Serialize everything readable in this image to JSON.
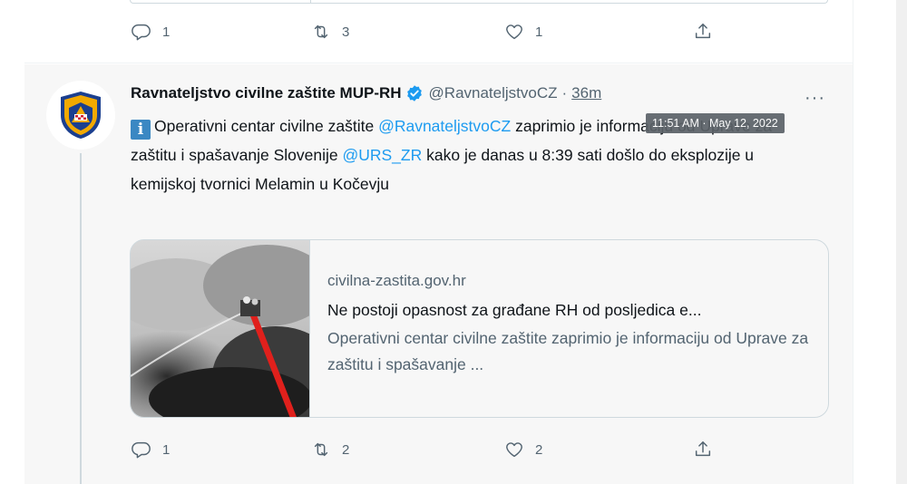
{
  "prev_tweet": {
    "actions": {
      "reply_count": "1",
      "retweet_count": "3",
      "like_count": "1"
    }
  },
  "tweet": {
    "author_name": "Ravnateljstvo civilne zaštite MUP-RH",
    "handle": "@RavnateljstvoCZ",
    "separator": "·",
    "time": "36m",
    "more": "···",
    "tooltip": "11:51 AM · May 12, 2022",
    "text": {
      "info_glyph": "i",
      "part1": "Operativni centar civilne zaštite ",
      "mention1": "@RavnateljstvoCZ",
      "part2": "  zaprimio je informaciju od Uprave za zaštitu i spašavanje Slovenije ",
      "mention2": "@URS_ZR",
      "part3": " kako je danas u 8:39 sati došlo do eksplozije u kemijskoj tvornici Melamin u Kočevju"
    },
    "card": {
      "domain": "civilna-zastita.gov.hr",
      "title": "Ne postoji opasnost za građane RH od posljedica e...",
      "description": "Operativni centar civilne zaštite zaprimio je informaciju od Uprave za zaštitu i spašavanje ..."
    },
    "actions": {
      "reply_count": "1",
      "retweet_count": "2",
      "like_count": "2"
    }
  },
  "icons": [
    "reply-icon",
    "retweet-icon",
    "like-icon",
    "share-icon",
    "verified-icon",
    "more-icon",
    "info-icon"
  ],
  "colors": {
    "link": "#1d9bf0",
    "secondary_text": "#536471",
    "verified": "#1d9bf0",
    "info_badge": "#3b88c3"
  }
}
